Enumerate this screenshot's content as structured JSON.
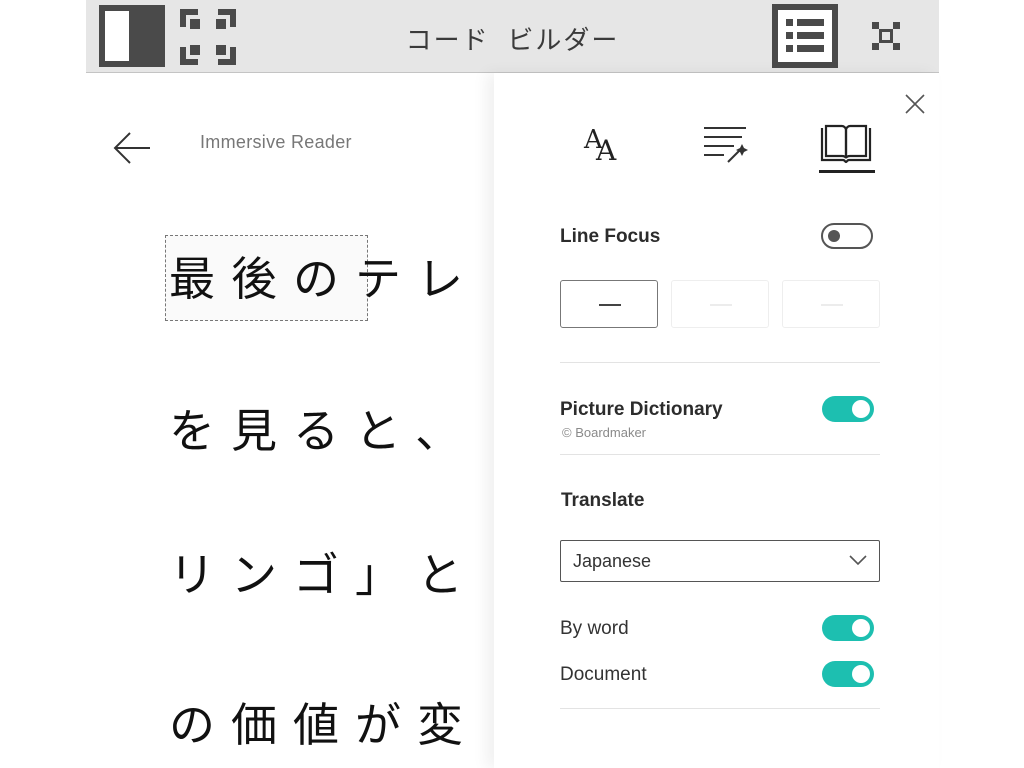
{
  "app": {
    "title": "コード ビルダー",
    "accent_color": "#1dbfb0"
  },
  "topbar": {
    "icons": [
      "panel-toggle-icon",
      "expand-icon",
      "list-icon",
      "close-icon"
    ]
  },
  "reader": {
    "title": "Immersive Reader",
    "lines": [
      "最後のテレ",
      "を見ると、",
      "リンゴ」と",
      "の価値が変"
    ],
    "highlighted_word": "最後の"
  },
  "settings": {
    "tabs": [
      "text-preferences-icon",
      "grammar-options-icon",
      "reading-preferences-icon"
    ],
    "active_tab": 2,
    "line_focus": {
      "label": "Line Focus",
      "enabled": false,
      "options": 3,
      "selected_option": 0
    },
    "picture_dictionary": {
      "label": "Picture Dictionary",
      "credit": "© Boardmaker",
      "enabled": true
    },
    "translate": {
      "label": "Translate",
      "language": "Japanese",
      "by_word": {
        "label": "By word",
        "enabled": true
      },
      "document": {
        "label": "Document",
        "enabled": true
      }
    }
  }
}
